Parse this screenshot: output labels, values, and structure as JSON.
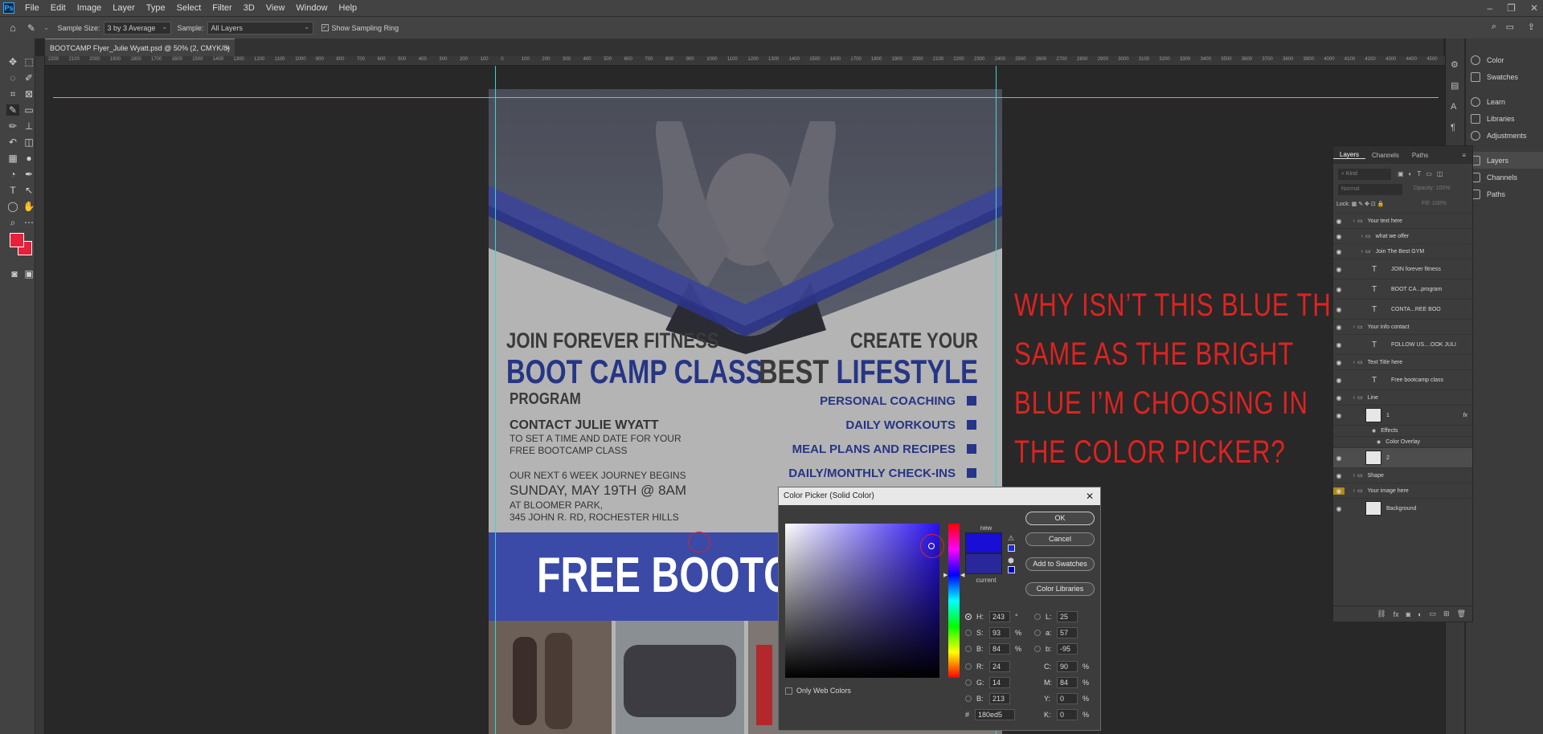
{
  "app": {
    "logo": "Ps"
  },
  "menu": [
    "File",
    "Edit",
    "Image",
    "Layer",
    "Type",
    "Select",
    "Filter",
    "3D",
    "View",
    "Window",
    "Help"
  ],
  "options_bar": {
    "sample_size_label": "Sample Size:",
    "sample_size_value": "3 by 3 Average",
    "sample_label": "Sample:",
    "sample_value": "All Layers",
    "show_ring_label": "Show Sampling Ring"
  },
  "document_tab": {
    "title": "BOOTCAMP Flyer_Julie Wyatt.psd @ 50% (2, CMYK/8)"
  },
  "ruler_top": [
    "2200",
    "2100",
    "2000",
    "1900",
    "1800",
    "1700",
    "1600",
    "1500",
    "1400",
    "1300",
    "1200",
    "1100",
    "1000",
    "900",
    "800",
    "700",
    "600",
    "500",
    "400",
    "300",
    "200",
    "100",
    "0",
    "100",
    "200",
    "300",
    "400",
    "500",
    "600",
    "700",
    "800",
    "900",
    "1000",
    "1100",
    "1200",
    "1300",
    "1400",
    "1500",
    "1600",
    "1700",
    "1800",
    "1900",
    "2000",
    "2100",
    "2200",
    "2300",
    "2400",
    "2500",
    "2600",
    "2700",
    "2800",
    "2900",
    "3000",
    "3100",
    "3200",
    "3300",
    "3400",
    "3500",
    "3600",
    "3700",
    "3800",
    "3900",
    "4000",
    "4100",
    "4200",
    "4300",
    "4400",
    "4500"
  ],
  "flyer": {
    "left_top": "JOIN FOREVER FITNESS",
    "left_big": "BOOT CAMP CLASS",
    "left_small": "PROGRAM",
    "right_top": "CREATE YOUR",
    "right_big_1": "BEST",
    "right_big_2": "LIFESTYLE",
    "services": [
      "PERSONAL COACHING",
      "DAILY WORKOUTS",
      "MEAL PLANS AND RECIPES",
      "DAILY/MONTHLY CHECK-INS"
    ],
    "contact_title": "CONTACT JULIE WYATT",
    "contact_lines": [
      "TO SET A TIME AND DATE FOR YOUR",
      "FREE BOOTCAMP CLASS"
    ],
    "journey": "OUR NEXT 6 WEEK JOURNEY BEGINS",
    "date": "SUNDAY, MAY 19TH @ 8AM",
    "location_lines": [
      "AT BLOOMER PARK,",
      "345 JOHN R. RD, ROCHESTER HILLS"
    ],
    "banner": "FREE BOOTCAMP",
    "banner_color": "#3a4aa6",
    "navy": "#263585"
  },
  "annotation": {
    "lines": [
      "WHY ISN’T THIS BLUE THE",
      "SAME AS THE BRIGHT",
      "BLUE I’M CHOOSING IN",
      "THE COLOR PICKER?"
    ],
    "color": "#dd2321"
  },
  "right_panel": {
    "items": [
      "Color",
      "Swatches",
      "Learn",
      "Libraries",
      "Adjustments",
      "Layers",
      "Channels",
      "Paths"
    ]
  },
  "layers_panel": {
    "tabs": [
      "Layers",
      "Channels",
      "Paths"
    ],
    "search_placeholder": "Kind",
    "blend": "Normal",
    "opacity_label": "Opacity:",
    "opacity_value": "100%",
    "lock_label": "Lock:",
    "fill_label": "Fill:",
    "fill_value": "100%",
    "rows": [
      {
        "name": "Your text here",
        "kind": "group"
      },
      {
        "name": "what we offer",
        "kind": "group"
      },
      {
        "name": "Join The Best GYM",
        "kind": "group"
      },
      {
        "name": "JOIN forever fitness",
        "kind": "text"
      },
      {
        "name": "BOOT CA...program",
        "kind": "text"
      },
      {
        "name": "CONTA...REE BOO",
        "kind": "text"
      },
      {
        "name": "Your info contact",
        "kind": "group"
      },
      {
        "name": "FOLLOW US....OOK JULI",
        "kind": "text"
      },
      {
        "name": "Text Title here",
        "kind": "group"
      },
      {
        "name": "Free bootcamp class",
        "kind": "text"
      },
      {
        "name": "Line",
        "kind": "group"
      },
      {
        "name": "1",
        "kind": "layer",
        "fx": "fx"
      },
      {
        "name": "Effects",
        "kind": "effect"
      },
      {
        "name": "Color Overlay",
        "kind": "effect"
      },
      {
        "name": "2",
        "kind": "layer"
      },
      {
        "name": "Shape",
        "kind": "group"
      },
      {
        "name": "Your image here",
        "kind": "group"
      },
      {
        "name": "Background",
        "kind": "layer"
      }
    ]
  },
  "color_picker": {
    "title": "Color Picker (Solid Color)",
    "ok": "OK",
    "cancel": "Cancel",
    "add_swatches": "Add to Swatches",
    "color_libraries": "Color Libraries",
    "new_label": "new",
    "current_label": "current",
    "new_color": "#180ed5",
    "current_color": "#28289a",
    "only_web": "Only Web Colors",
    "hex_label": "#",
    "hex_value": "180ed5",
    "fields": {
      "H": "243",
      "S": "93",
      "B": "84",
      "R": "24",
      "G": "14",
      "B2": "213",
      "L": "25",
      "a": "57",
      "b": "-95",
      "C": "90",
      "M": "84",
      "Y": "0",
      "K": "0"
    },
    "units": {
      "deg": "°",
      "pct": "%"
    }
  }
}
